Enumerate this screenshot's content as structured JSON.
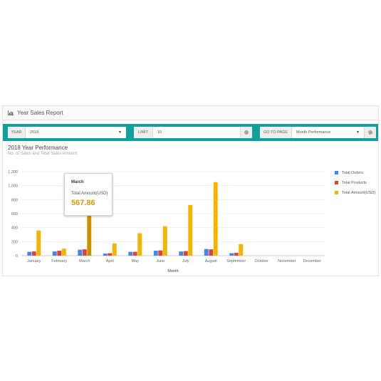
{
  "panel": {
    "title": "Year Sales Report"
  },
  "toolbar": {
    "year_label": "YEAR",
    "year_value": "2018",
    "limit_label": "LIMIT",
    "limit_value": "10",
    "goto_label": "GO TO PAGE",
    "goto_value": "Month Performance"
  },
  "report": {
    "title": "2018 Year Performance",
    "subtitle": "No. of Sales and Total Sales Amount"
  },
  "tooltip": {
    "title": "March",
    "label": "Total Amount(USD)",
    "value": "567.86"
  },
  "colors": {
    "accent": "#0fa19a",
    "orders": "#4285f4",
    "products": "#db4437",
    "amount": "#f4b400",
    "highlight": "#c99300"
  },
  "chart_data": {
    "type": "bar",
    "categories": [
      "January",
      "February",
      "March",
      "April",
      "May",
      "June",
      "July",
      "August",
      "September",
      "October",
      "November",
      "December"
    ],
    "series": [
      {
        "name": "Total Orders",
        "color": "#4285f4",
        "values": [
          55,
          60,
          85,
          30,
          55,
          70,
          60,
          95,
          35,
          0,
          0,
          0
        ]
      },
      {
        "name": "Total Products",
        "color": "#db4437",
        "values": [
          60,
          70,
          90,
          35,
          55,
          75,
          65,
          90,
          40,
          0,
          0,
          0
        ]
      },
      {
        "name": "Total Amount(USD)",
        "color": "#f4b400",
        "values": [
          360,
          100,
          567.86,
          175,
          320,
          420,
          725,
          1050,
          165,
          0,
          0,
          0
        ]
      }
    ],
    "highlight": {
      "series": 2,
      "index": 2
    },
    "xlabel": "Month",
    "ylabel": "",
    "ylim": [
      0,
      1200
    ],
    "yticks": [
      0,
      200,
      400,
      600,
      800,
      1000,
      1200
    ],
    "ytick_labels": [
      "0",
      "200",
      "400",
      "600",
      "800",
      "1,000",
      "1,200"
    ],
    "grid": true,
    "legend": "right"
  }
}
